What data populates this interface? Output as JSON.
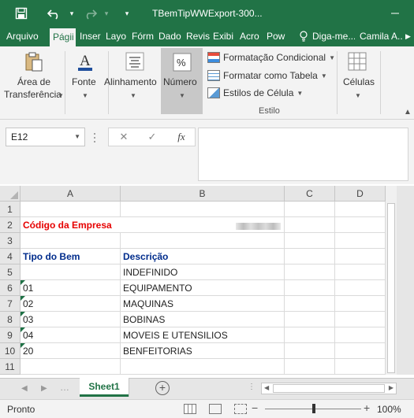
{
  "window": {
    "title": "TBemTipWWExport-300...",
    "save_icon": "save-icon",
    "undo_icon": "undo-icon",
    "redo_icon": "redo-icon"
  },
  "ribbon_tabs": [
    {
      "label": "Arquivo",
      "active": false
    },
    {
      "label": "Págii",
      "active": true
    },
    {
      "label": "Inser",
      "active": false
    },
    {
      "label": "Layo",
      "active": false
    },
    {
      "label": "Fórm",
      "active": false
    },
    {
      "label": "Dado",
      "active": false
    },
    {
      "label": "Revis",
      "active": false
    },
    {
      "label": "Exibi",
      "active": false
    },
    {
      "label": "Acro",
      "active": false
    },
    {
      "label": "Pow",
      "active": false
    }
  ],
  "tell_me": "Diga-me...",
  "user": "Camila A...",
  "ribbon": {
    "clipboard_line1": "Área de",
    "clipboard_line2": "Transferência",
    "font": "Fonte",
    "alignment": "Alinhamento",
    "number": "Número",
    "number_symbol": "%",
    "cond_format": "Formatação Condicional",
    "format_table": "Formatar como Tabela",
    "cell_styles": "Estilos de Célula",
    "style_group": "Estilo",
    "cells": "Células"
  },
  "formula_bar": {
    "name_box": "E12",
    "cancel": "✕",
    "enter": "✓",
    "fx": "fx",
    "content": ""
  },
  "columns": [
    "A",
    "B",
    "C",
    "D"
  ],
  "rows": [
    {
      "n": "1",
      "a": "",
      "b": ""
    },
    {
      "n": "2",
      "a": "Código da Empresa",
      "b": ""
    },
    {
      "n": "3",
      "a": "",
      "b": ""
    },
    {
      "n": "4",
      "a": "Tipo do Bem",
      "b": "Descrição"
    },
    {
      "n": "5",
      "a": "",
      "b": "INDEFINIDO"
    },
    {
      "n": "6",
      "a": "01",
      "b": "EQUIPAMENTO"
    },
    {
      "n": "7",
      "a": "02",
      "b": "MAQUINAS"
    },
    {
      "n": "8",
      "a": "03",
      "b": "BOBINAS"
    },
    {
      "n": "9",
      "a": "04",
      "b": "MOVEIS E UTENSILIOS"
    },
    {
      "n": "10",
      "a": "20",
      "b": "BENFEITORIAS"
    },
    {
      "n": "11",
      "a": "",
      "b": ""
    }
  ],
  "sheet_tab": "Sheet1",
  "status": "Pronto",
  "zoom": "100%",
  "colors": {
    "excel_green": "#217346",
    "red_label": "#e60000",
    "navy_label": "#002c8c"
  }
}
